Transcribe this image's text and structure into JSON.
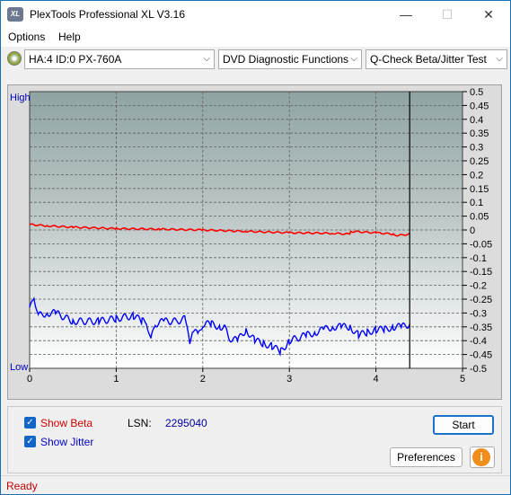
{
  "window": {
    "title": "PlexTools Professional XL V3.16",
    "app_icon_text": "XL",
    "minimize": "—",
    "maximize": "☐",
    "close": "✕"
  },
  "menu": {
    "options": "Options",
    "help": "Help"
  },
  "toolbar": {
    "drive": "HA:4 ID:0  PX-760A",
    "function": "DVD Diagnostic Functions",
    "test": "Q-Check Beta/Jitter Test",
    "dropdown_arrow": "⌵"
  },
  "chart_data": {
    "type": "line",
    "ylabel_high": "High",
    "ylabel_low": "Low",
    "x_ticks": [
      "0",
      "1",
      "2",
      "3",
      "4",
      "5"
    ],
    "xlim": [
      0,
      5
    ],
    "y_right_ticks": [
      "0.5",
      "0.45",
      "0.4",
      "0.35",
      "0.3",
      "0.25",
      "0.2",
      "0.15",
      "0.1",
      "0.05",
      "0",
      "-0.05",
      "-0.1",
      "-0.15",
      "-0.2",
      "-0.25",
      "-0.3",
      "-0.35",
      "-0.4",
      "-0.45",
      "-0.5"
    ],
    "ylim": [
      -0.5,
      0.5
    ],
    "grid": true,
    "end_marker_x": 4.39,
    "series": [
      {
        "name": "Beta",
        "color": "#ff0000",
        "x": [
          0,
          0.2,
          0.5,
          1.0,
          1.5,
          2.0,
          2.5,
          3.0,
          3.5,
          3.7,
          3.71,
          4.0,
          4.2,
          4.25,
          4.39
        ],
        "y": [
          0.02,
          0.015,
          0.01,
          0.005,
          0.003,
          0.0,
          -0.005,
          -0.01,
          -0.012,
          -0.015,
          -0.005,
          -0.01,
          -0.015,
          -0.02,
          -0.015
        ]
      },
      {
        "name": "Jitter",
        "color": "#0000ff",
        "x": [
          0,
          0.05,
          0.1,
          0.2,
          0.3,
          0.5,
          0.8,
          1.0,
          1.2,
          1.3,
          1.35,
          1.4,
          1.45,
          1.55,
          1.7,
          1.8,
          1.85,
          1.88,
          1.95,
          2.0,
          2.1,
          2.2,
          2.25,
          2.3,
          2.4,
          2.5,
          2.6,
          2.7,
          2.8,
          2.9,
          3.0,
          3.2,
          3.3,
          3.4,
          3.5,
          3.6,
          3.7,
          3.8,
          3.9,
          4.0,
          4.1,
          4.2,
          4.3,
          4.39
        ],
        "y": [
          -0.29,
          -0.24,
          -0.31,
          -0.3,
          -0.3,
          -0.33,
          -0.33,
          -0.32,
          -0.31,
          -0.33,
          -0.33,
          -0.4,
          -0.34,
          -0.33,
          -0.33,
          -0.32,
          -0.42,
          -0.36,
          -0.38,
          -0.34,
          -0.34,
          -0.35,
          -0.35,
          -0.39,
          -0.4,
          -0.36,
          -0.4,
          -0.41,
          -0.42,
          -0.44,
          -0.4,
          -0.38,
          -0.37,
          -0.36,
          -0.35,
          -0.35,
          -0.35,
          -0.38,
          -0.37,
          -0.36,
          -0.36,
          -0.35,
          -0.35,
          -0.34
        ]
      }
    ]
  },
  "controls": {
    "show_beta": "Show Beta",
    "show_beta_color": "#d00000",
    "show_jitter": "Show Jitter",
    "show_jitter_color": "#0000c0",
    "checkmark": "✓",
    "lsn_label": "LSN:",
    "lsn_value": "2295040",
    "start": "Start",
    "preferences": "Preferences",
    "info": "i"
  },
  "status": {
    "text": "Ready"
  }
}
